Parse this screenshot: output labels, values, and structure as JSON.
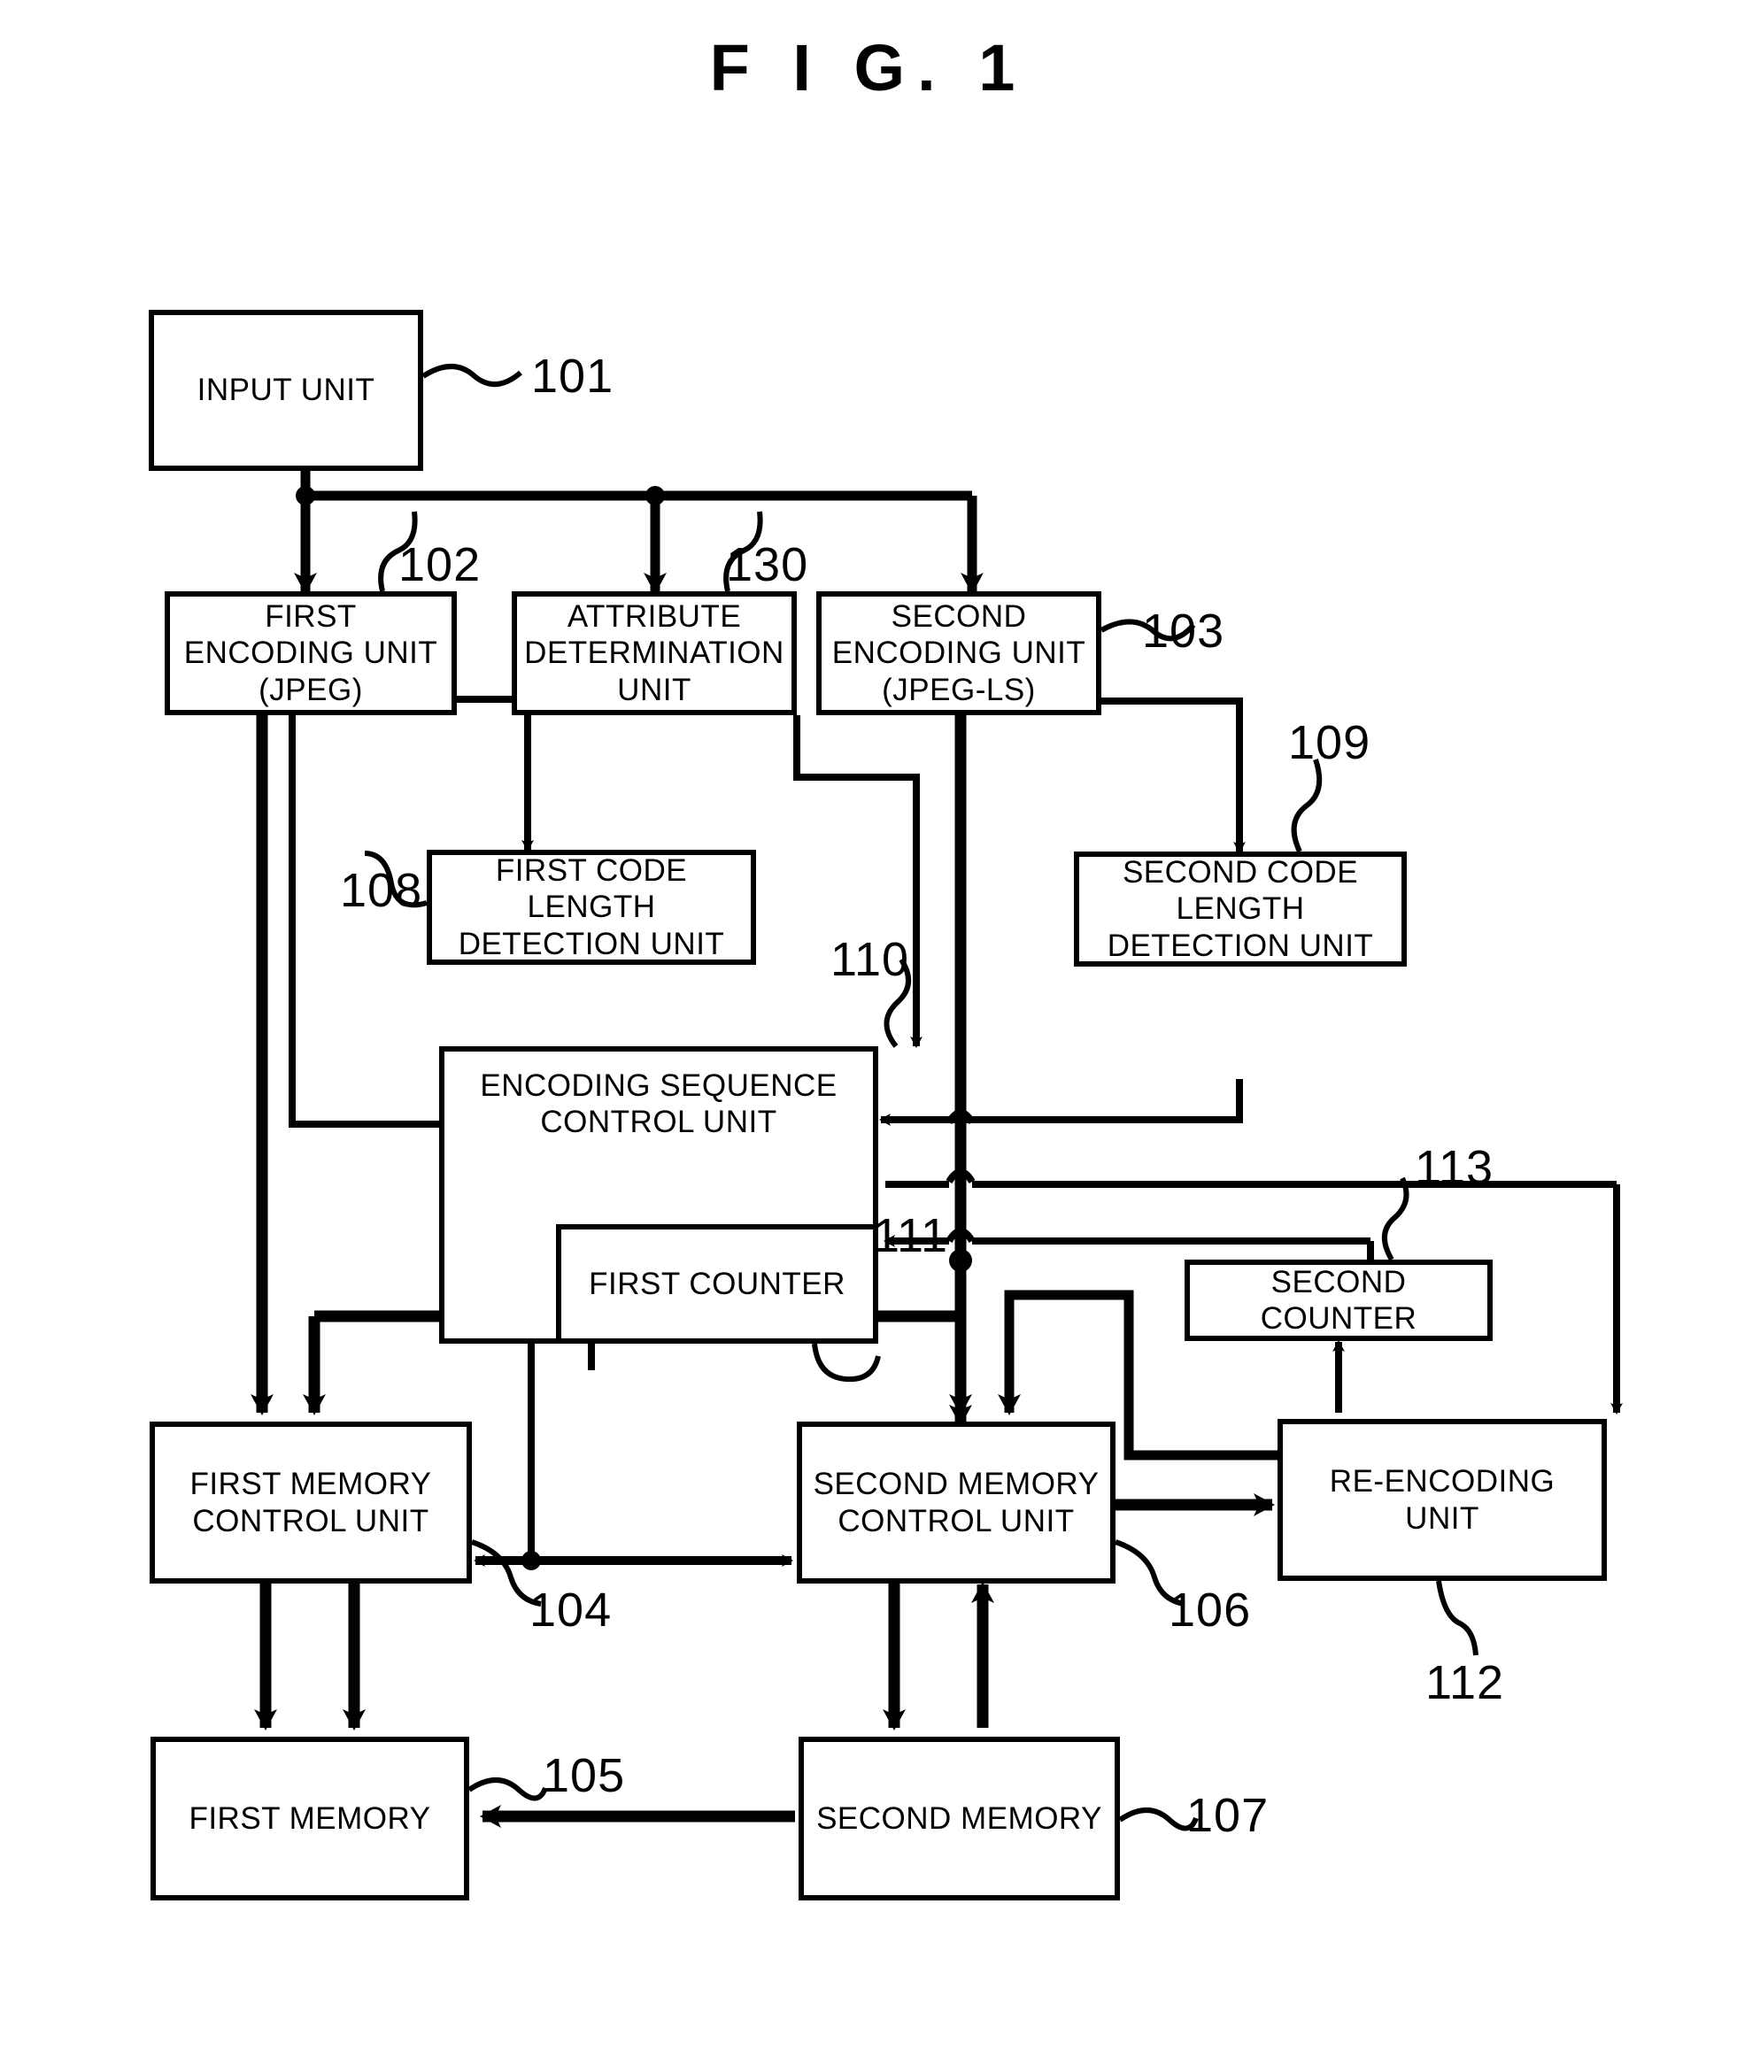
{
  "figure": {
    "title": "F I G.  1",
    "type": "patent-block-diagram"
  },
  "blocks": [
    {
      "id": "101",
      "label": "INPUT UNIT"
    },
    {
      "id": "102",
      "label": "FIRST\nENCODING UNIT\n(JPEG)"
    },
    {
      "id": "130",
      "label": "ATTRIBUTE\nDETERMINATION\nUNIT"
    },
    {
      "id": "103",
      "label": "SECOND\nENCODING UNIT\n(JPEG-LS)"
    },
    {
      "id": "108",
      "label": "FIRST CODE\nLENGTH\nDETECTION UNIT"
    },
    {
      "id": "109",
      "label": "SECOND CODE\nLENGTH\nDETECTION UNIT"
    },
    {
      "id": "110",
      "label": "ENCODING SEQUENCE\nCONTROL UNIT"
    },
    {
      "id": "111",
      "label": "FIRST COUNTER"
    },
    {
      "id": "113",
      "label": "SECOND COUNTER"
    },
    {
      "id": "104",
      "label": "FIRST MEMORY\nCONTROL UNIT"
    },
    {
      "id": "106",
      "label": "SECOND MEMORY\nCONTROL UNIT"
    },
    {
      "id": "112",
      "label": "RE-ENCODING\nUNIT"
    },
    {
      "id": "105",
      "label": "FIRST MEMORY"
    },
    {
      "id": "107",
      "label": "SECOND MEMORY"
    }
  ],
  "labels": {
    "input_unit": "INPUT UNIT",
    "first_encoding_unit_l1": "FIRST",
    "first_encoding_unit_l2": "ENCODING UNIT",
    "first_encoding_unit_l3": "(JPEG)",
    "attribute_determination_l1": "ATTRIBUTE",
    "attribute_determination_l2": "DETERMINATION",
    "attribute_determination_l3": "UNIT",
    "second_encoding_unit_l1": "SECOND",
    "second_encoding_unit_l2": "ENCODING UNIT",
    "second_encoding_unit_l3": "(JPEG-LS)",
    "first_code_length_l1": "FIRST CODE",
    "first_code_length_l2": "LENGTH",
    "first_code_length_l3": "DETECTION UNIT",
    "second_code_length_l1": "SECOND CODE",
    "second_code_length_l2": "LENGTH",
    "second_code_length_l3": "DETECTION UNIT",
    "encoding_sequence_l1": "ENCODING SEQUENCE",
    "encoding_sequence_l2": "CONTROL UNIT",
    "first_counter": "FIRST COUNTER",
    "second_counter": "SECOND COUNTER",
    "first_memory_control_l1": "FIRST MEMORY",
    "first_memory_control_l2": "CONTROL UNIT",
    "second_memory_control_l1": "SECOND MEMORY",
    "second_memory_control_l2": "CONTROL UNIT",
    "re_encoding_unit_l1": "RE-ENCODING",
    "re_encoding_unit_l2": "UNIT",
    "first_memory": "FIRST MEMORY",
    "second_memory": "SECOND MEMORY"
  },
  "reference_numerals": {
    "n101": "101",
    "n102": "102",
    "n103": "103",
    "n104": "104",
    "n105": "105",
    "n106": "106",
    "n107": "107",
    "n108": "108",
    "n109": "109",
    "n110": "110",
    "n111": "111",
    "n112": "112",
    "n113": "113",
    "n130": "130"
  },
  "colors": {
    "ink": "#000000",
    "paper": "#ffffff"
  }
}
